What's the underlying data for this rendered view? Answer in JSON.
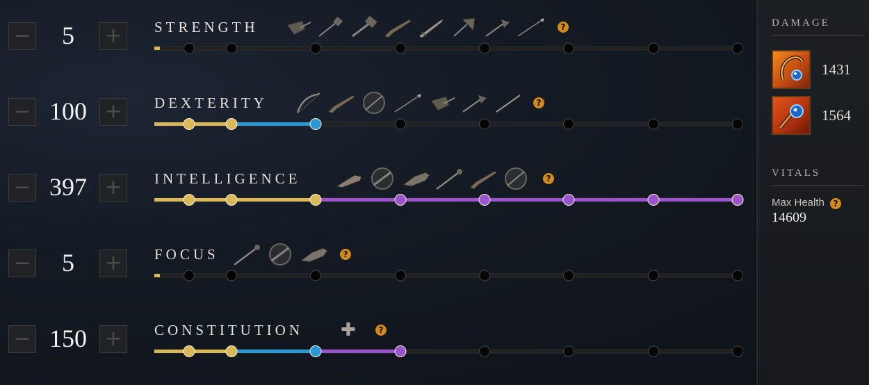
{
  "colors": {
    "gold": "#d9b85a",
    "blue": "#2b98d6",
    "purple": "#9a55cc",
    "node_empty": "#050505",
    "track_dark": "#202020",
    "help": "#d38a1c"
  },
  "stats": [
    {
      "name": "STRENGTH",
      "value": "5",
      "weapons": [
        "round-shield-icon",
        "war-hammer-icon",
        "great-hammer-icon",
        "musket-icon",
        "sword-icon",
        "great-axe-icon",
        "hatchet-icon",
        "spear-icon"
      ],
      "has_bonus_icon": false,
      "progress": 0.01,
      "node_types": [
        "gold",
        "empty",
        "empty",
        "empty",
        "empty",
        "empty",
        "empty",
        "empty",
        "empty"
      ]
    },
    {
      "name": "DEXTERITY",
      "value": "100",
      "weapons": [
        "bow-icon",
        "musket-icon",
        "blunderbuss-icon",
        "spear-icon",
        "round-shield-icon",
        "hatchet-icon",
        "rapier-icon"
      ],
      "has_bonus_icon": false,
      "progress": 0.275,
      "node_types": [
        "gold",
        "gold",
        "gold",
        "blue",
        "empty",
        "empty",
        "empty",
        "empty",
        "empty"
      ]
    },
    {
      "name": "INTELLIGENCE",
      "value": "397",
      "weapons": [
        "fire-staff-icon",
        "void-gauntlet-icon",
        "ice-gauntlet-icon",
        "life-staff-icon",
        "musket-icon",
        "blunderbuss-icon"
      ],
      "has_bonus_icon": false,
      "progress": 1.0,
      "node_types": [
        "gold",
        "gold",
        "gold",
        "gold",
        "purple",
        "purple",
        "purple",
        "purple",
        "purple"
      ]
    },
    {
      "name": "FOCUS",
      "value": "5",
      "weapons": [
        "life-staff-icon",
        "void-gauntlet-icon",
        "ice-gauntlet-icon"
      ],
      "has_bonus_icon": false,
      "progress": 0.01,
      "node_types": [
        "gold",
        "empty",
        "empty",
        "empty",
        "empty",
        "empty",
        "empty",
        "empty",
        "empty"
      ]
    },
    {
      "name": "CONSTITUTION",
      "value": "150",
      "weapons": [],
      "has_bonus_icon": true,
      "bonus_icon": "health-plus-icon",
      "progress": 0.415,
      "node_types": [
        "gold",
        "gold",
        "gold",
        "blue",
        "purple",
        "empty",
        "empty",
        "empty",
        "empty"
      ]
    }
  ],
  "buttons": {
    "minus_icon": "−",
    "plus_icon": "+"
  },
  "help_icon": "?",
  "bonus_plus": "✚",
  "sidebar": {
    "damage_label": "DAMAGE",
    "damage_items": [
      {
        "icon": "fire-staff-icon",
        "value": "1431"
      },
      {
        "icon": "life-staff-icon",
        "value": "1564"
      }
    ],
    "vitals_label": "VITALS",
    "max_health_label": "Max Health",
    "max_health_value": "14609"
  }
}
